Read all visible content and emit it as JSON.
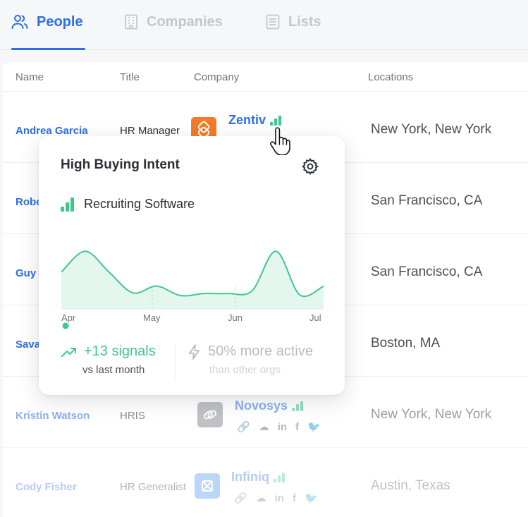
{
  "tabs": [
    {
      "label": "People",
      "icon": "people-icon",
      "active": true
    },
    {
      "label": "Companies",
      "icon": "building-icon",
      "active": false
    },
    {
      "label": "Lists",
      "icon": "list-icon",
      "active": false
    }
  ],
  "table": {
    "headers": [
      "Name",
      "Title",
      "Company",
      "Locations"
    ],
    "rows": [
      {
        "name": "Andrea Garcia",
        "title": "HR Manager",
        "company": "Zentiv",
        "location": "New York, New York"
      },
      {
        "name": "Robe",
        "title": "",
        "company": "",
        "location": "San Francisco, CA"
      },
      {
        "name": "Guy",
        "title": "",
        "company": "",
        "location": "San Francisco, CA"
      },
      {
        "name": "Sava",
        "title": "",
        "company": "",
        "location": "Boston, MA"
      },
      {
        "name": "Kristin Watson",
        "title": "HRIS",
        "company": "Novosys",
        "location": "New York, New York"
      },
      {
        "name": "Cody Fisher",
        "title": "HR Generalist",
        "company": "Infiniq",
        "location": "Austin, Texas"
      }
    ]
  },
  "popover": {
    "title": "High Buying Intent",
    "topic": "Recruiting Software",
    "months": [
      "Apr",
      "May",
      "Jun",
      "Jul"
    ],
    "signals": "+13 signals",
    "signals_sub": "vs last month",
    "activity": "50% more active",
    "activity_sub": "than other orgs"
  },
  "chart_data": {
    "type": "area",
    "x": [
      "Apr",
      "May",
      "Jun",
      "Jul"
    ],
    "series": [
      {
        "values": [
          0.55,
          0.86,
          0.55,
          0.24,
          0.34,
          0.2,
          0.23,
          0.23,
          0.27,
          0.86,
          0.21,
          0.34
        ]
      }
    ],
    "grid": false
  },
  "colors": {
    "accent": "#2c6ee8",
    "intent_green": "#3cc98a",
    "zentiv_orange": "#f47a2a",
    "novosys_gray": "#8b8f95",
    "infiniq_blue": "#3f8be8"
  }
}
